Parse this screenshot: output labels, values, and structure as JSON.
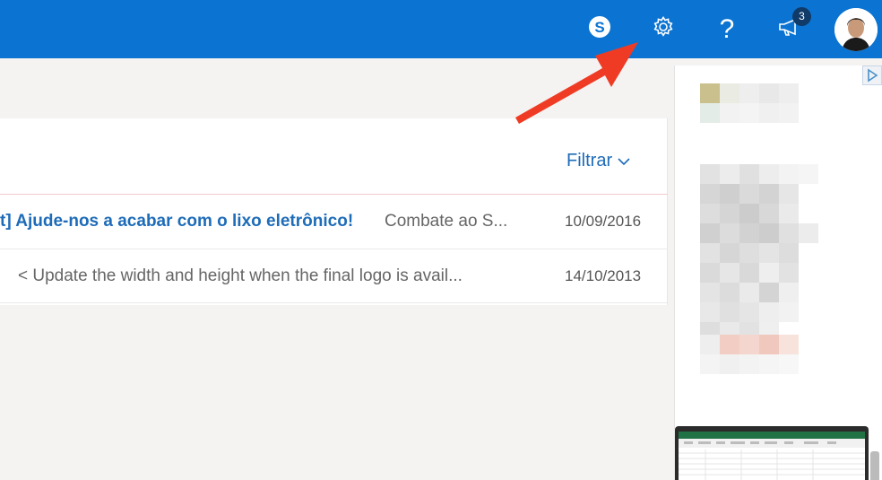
{
  "header": {
    "help_label": "?",
    "notifications_count": "3",
    "icons": [
      "skype-icon",
      "gear-icon",
      "help-icon",
      "megaphone-icon",
      "avatar"
    ]
  },
  "message_list": {
    "filter_label": "Filtrar",
    "messages": [
      {
        "subject": "t] Ajude-nos a acabar com o lixo eletrônico!",
        "preview": "Combate ao S...",
        "date": "10/09/2016",
        "unread": true
      },
      {
        "subject": "",
        "preview": "< Update the width and height when the final logo is avail...",
        "date": "14/10/2013",
        "unread": false
      }
    ]
  },
  "colors": {
    "header_bg": "#0b74d2",
    "link_blue": "#1e6cb8",
    "arrow_red": "#ef3b24",
    "badge_bg": "#103a68"
  }
}
